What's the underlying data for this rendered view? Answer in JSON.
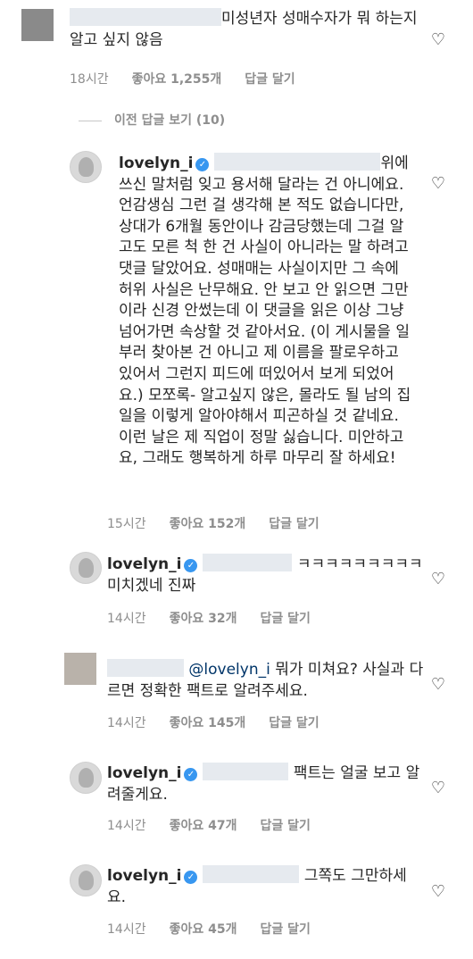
{
  "c1": {
    "text": "미성년자 성매수자가 뭐 하는지 알고 싶지 않음",
    "time": "18시간",
    "likes": "좋아요 1,255개",
    "reply": "답글 달기",
    "heart_icon": "heart-outline-icon"
  },
  "replies_toggle": {
    "label": "이전 답글 보기 (10)"
  },
  "c2": {
    "username": "lovelyn_i",
    "text": "위에 쓰신 말처럼 잊고 용서해 달라는 건 아니에요. 언감생심 그런 걸 생각해 본 적도 없습니다만, 상대가 6개월 동안이나 감금당했는데 그걸 알고도 모른 척 한 건 사실이 아니라는 말 하려고 댓글 달았어요. 성매매는 사실이지만 그 속에 허위 사실은 난무해요. 안 보고 안 읽으면 그만이라 신경 안썼는데 이 댓글을 읽은 이상 그냥 넘어가면 속상할 것 같아서요. (이 게시물을 일부러 찾아본 건 아니고 제 이름을 팔로우하고 있어서 그런지 피드에 떠있어서 보게 되었어요.) 모쪼록- 알고싶지 않은, 몰라도 될 남의 집 일을 이렇게 알아야해서 피곤하실 것 같네요. 이런 날은 제 직업이 정말 싫습니다. 미안하고요, 그래도 행복하게 하루 마무리 잘 하세요!",
    "time": "15시간",
    "likes": "좋아요 152개",
    "reply": "답글 달기"
  },
  "c3": {
    "username": "lovelyn_i",
    "text": "ㅋㅋㅋㅋㅋㅋㅋㅋㅋ 미치겠네 진짜",
    "time": "14시간",
    "likes": "좋아요 32개",
    "reply": "답글 달기"
  },
  "c4": {
    "mention": "@lovelyn_i",
    "text": "뭐가 미쳐요? 사실과 다르면 정확한 팩트로 알려주세요.",
    "time": "14시간",
    "likes": "좋아요 145개",
    "reply": "답글 달기"
  },
  "c5": {
    "username": "lovelyn_i",
    "text": "팩트는 얼굴 보고 알려줄게요.",
    "time": "14시간",
    "likes": "좋아요 47개",
    "reply": "답글 달기"
  },
  "c6": {
    "username": "lovelyn_i",
    "text": "그쪽도 그만하세요.",
    "time": "14시간",
    "likes": "좋아요 45개",
    "reply": "답글 달기"
  },
  "colors": {
    "accent": "#3897f0",
    "mention": "#003569",
    "meta": "#8e8e8e"
  }
}
